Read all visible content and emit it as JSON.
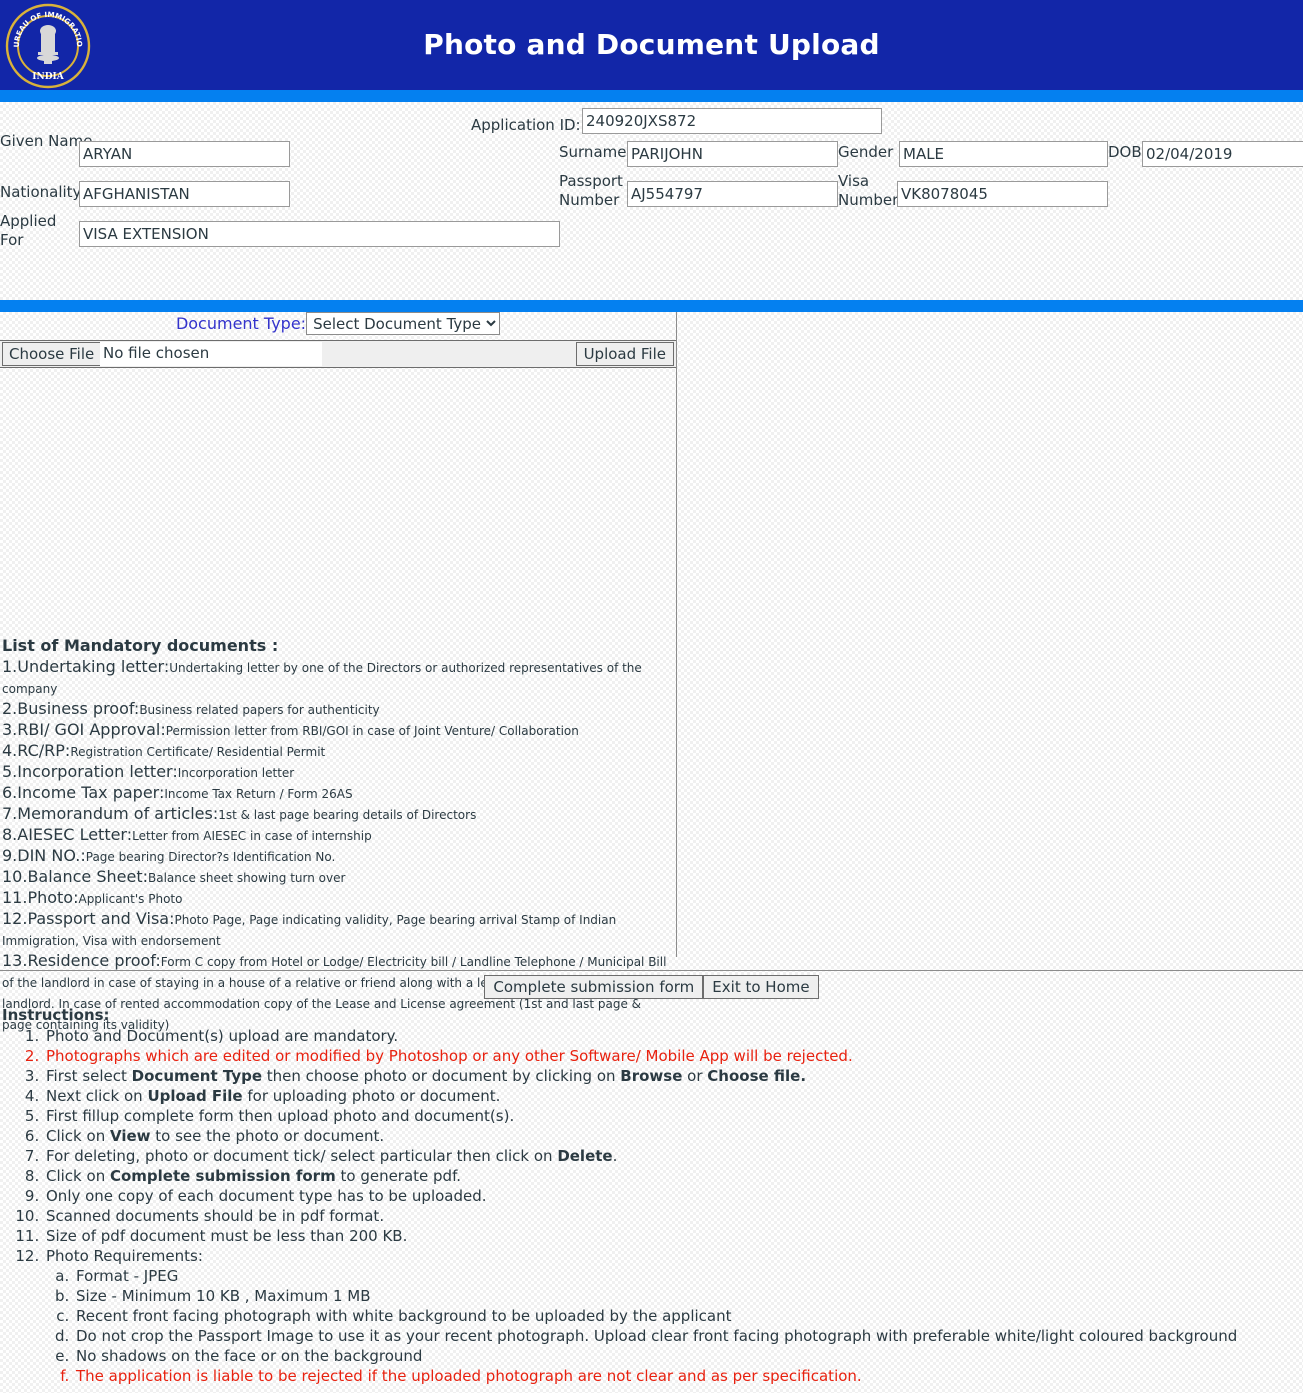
{
  "header": {
    "title": "Photo and Document Upload",
    "logo_alt": "Bureau of Immigration India emblem",
    "logo_text_top": "BUREAU OF IMMIGRATION",
    "logo_text_bottom": "INDIA",
    "bg_color": "#1226a8",
    "bar_color": "#0480f0"
  },
  "applicant": {
    "application_id_label": "Application ID:",
    "application_id_value": "240920JXS872",
    "given_name_label": "Given Name",
    "given_name_value": "ARYAN",
    "surname_label": "Surname",
    "surname_value": "PARIJOHN",
    "gender_label": "Gender",
    "gender_value": "MALE",
    "dob_label": "DOB",
    "dob_value": "02/04/2019",
    "nationality_label": "Nationality",
    "nationality_value": "AFGHANISTAN",
    "passport_label": "Passport Number",
    "passport_value": "AJ554797",
    "visa_label": "Visa Number",
    "visa_value": "VK8078045",
    "applied_for_label": "Applied For",
    "applied_for_value": "VISA EXTENSION"
  },
  "upload": {
    "document_type_label": "Document Type:",
    "document_type_selected": "Select Document Type",
    "document_type_label_color": "#3333cc",
    "choose_file_label": "Choose File",
    "file_name_value": "No file chosen",
    "upload_file_label": "Upload File"
  },
  "mandatory": {
    "heading": "List of Mandatory documents :",
    "items": [
      {
        "num": "1.",
        "title": "Undertaking letter:",
        "desc": "Undertaking letter by one of the Directors or authorized representatives of the company"
      },
      {
        "num": "2.",
        "title": "Business proof:",
        "desc": "Business related papers for authenticity"
      },
      {
        "num": "3.",
        "title": "RBI/ GOI Approval:",
        "desc": "Permission letter from RBI/GOI in case of Joint Venture/ Collaboration"
      },
      {
        "num": "4.",
        "title": "RC/RP:",
        "desc": "Registration Certificate/ Residential Permit"
      },
      {
        "num": "5.",
        "title": "Incorporation letter:",
        "desc": "Incorporation letter"
      },
      {
        "num": "6.",
        "title": "Income Tax paper:",
        "desc": "Income Tax Return / Form 26AS"
      },
      {
        "num": "7.",
        "title": "Memorandum of articles:",
        "desc": "1st & last page bearing details of Directors"
      },
      {
        "num": "8.",
        "title": "AIESEC Letter:",
        "desc": "Letter from AIESEC in case of internship"
      },
      {
        "num": "9.",
        "title": "DIN NO.:",
        "desc": "Page bearing Director?s Identification No."
      },
      {
        "num": "10.",
        "title": "Balance Sheet:",
        "desc": "Balance sheet showing turn over"
      },
      {
        "num": "11.",
        "title": "Photo:",
        "desc": "Applicant's Photo"
      },
      {
        "num": "12.",
        "title": "Passport and Visa:",
        "desc": "Photo Page, Page indicating validity, Page bearing arrival Stamp of Indian Immigration, Visa with endorsement"
      },
      {
        "num": "13.",
        "title": "Residence proof:",
        "desc": "Form C copy from Hotel or Lodge/ Electricity bill / Landline Telephone / Municipal Bill of the landlord in case of staying in a house of a relative or friend along with a letter and photo-id card of the landlord. In case of rented accommodation copy of the Lease and License agreement (1st and last page & page containing its validity)"
      }
    ]
  },
  "actions": {
    "complete_label": "Complete submission form",
    "exit_label": "Exit to Home"
  },
  "instructions": {
    "heading": "Instructions:",
    "red_color": "#e8210f",
    "items": [
      {
        "text": "Photo and Document(s) upload are mandatory."
      },
      {
        "text": "Photographs which are edited or modified by Photoshop or any other Software/ Mobile App will be rejected.",
        "red": true
      },
      {
        "html": "First select <b>Document Type</b> then choose photo or document by clicking on <b>Browse</b> or <b>Choose file.</b>"
      },
      {
        "html": "Next click on <b>Upload File</b> for uploading photo or document."
      },
      {
        "text": "First fillup complete form then upload photo and document(s)."
      },
      {
        "html": "Click on <b>View</b> to see the photo or document."
      },
      {
        "html": "For deleting, photo or document tick/ select particular then click on <b>Delete</b>."
      },
      {
        "html": "Click on <b>Complete submission form</b> to generate pdf."
      },
      {
        "text": "Only one copy of each document type has to be uploaded."
      },
      {
        "text": "Scanned documents should be in pdf format."
      },
      {
        "text": "Size of pdf document must be less than 200 KB."
      },
      {
        "text": "Photo Requirements:",
        "sub": [
          {
            "text": "Format - JPEG"
          },
          {
            "text": "Size - Minimum 10 KB , Maximum 1 MB"
          },
          {
            "text": "Recent front facing photograph with white background to be uploaded by the applicant"
          },
          {
            "text": "Do not crop the Passport Image to use it as your recent photograph. Upload clear front facing photograph with preferable white/light coloured background"
          },
          {
            "text": "No shadows on the face or on the background"
          },
          {
            "text": "The application is liable to be rejected if the uploaded photograph are not clear and as per specification.",
            "red": true
          }
        ]
      }
    ]
  }
}
